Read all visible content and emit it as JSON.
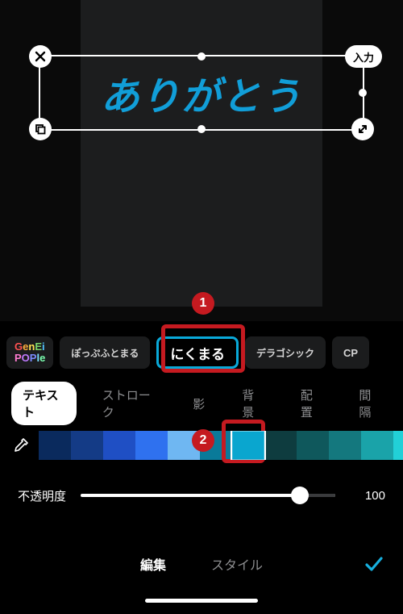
{
  "canvas": {
    "text_content": "ありがとう",
    "text_color": "#119ed8",
    "input_pill_label": "入力",
    "close_icon": "close-icon",
    "copy_icon": "copy-icon",
    "resize_icon": "resize-icon"
  },
  "fonts": {
    "items": [
      {
        "label": "GenEi\nPOPle",
        "key": "genei-pople"
      },
      {
        "label": "ぽっぷふとまる",
        "key": "popfutomaru"
      },
      {
        "label": "にくまる",
        "key": "nikumaru",
        "selected": true
      },
      {
        "label": "デラゴシック",
        "key": "dela-gothic"
      },
      {
        "label": "CP",
        "key": "cp"
      }
    ]
  },
  "callouts": {
    "font": "1",
    "color": "2"
  },
  "tabs": {
    "items": [
      "テキスト",
      "ストローク",
      "影",
      "背景",
      "配置",
      "間隔"
    ],
    "active_index": 0
  },
  "color_row": {
    "eyedropper_icon": "eyedropper-icon",
    "swatches": [
      {
        "hex": "#0a2a5d"
      },
      {
        "hex": "#143b86"
      },
      {
        "hex": "#1f4fc4"
      },
      {
        "hex": "#2f71ef"
      },
      {
        "hex": "#6fb7f2"
      },
      {
        "hex": "#0a7a99"
      },
      {
        "hex": "#0aa6cf",
        "selected": true
      },
      {
        "hex": "#0e3c3f"
      },
      {
        "hex": "#0f585c"
      },
      {
        "hex": "#14787e"
      },
      {
        "hex": "#1aa3a9"
      },
      {
        "hex": "#22d0d7"
      }
    ]
  },
  "opacity": {
    "label": "不透明度",
    "value": "100"
  },
  "bottom": {
    "edit_label": "編集",
    "style_label": "スタイル",
    "confirm_icon": "check-icon"
  }
}
